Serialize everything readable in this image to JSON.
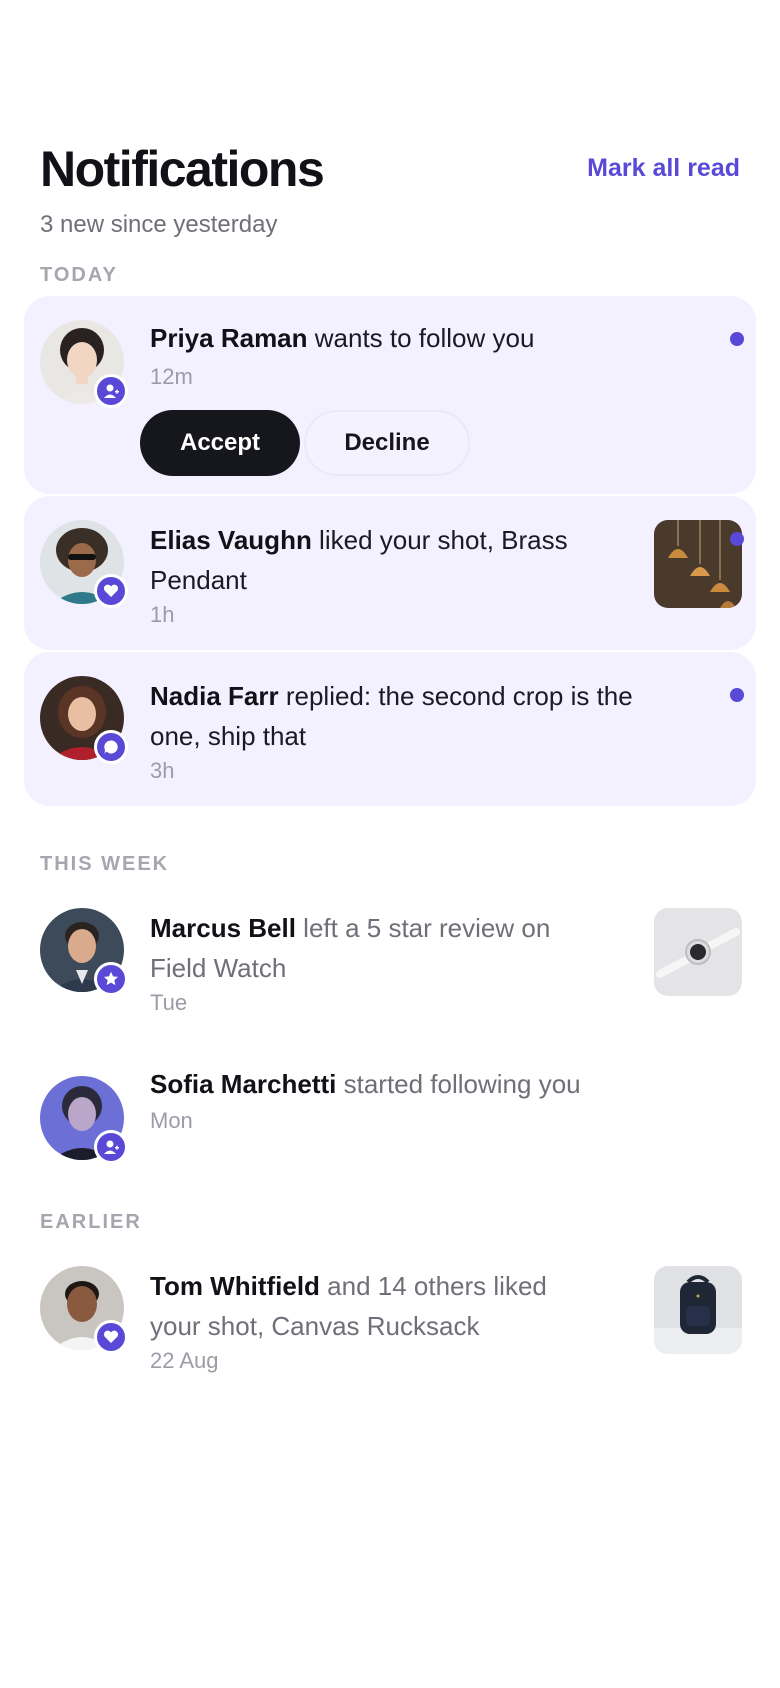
{
  "header": {
    "title": "Notifications",
    "subtitle": "3 new since yesterday",
    "mark_all": "Mark all read"
  },
  "sections": {
    "today": "TODAY",
    "this_week": "THIS WEEK",
    "earlier": "EARLIER"
  },
  "colors": {
    "accent": "#5a49d6",
    "unread_bg": "#f3f1ff",
    "primary_button": "#16161d"
  },
  "notifications": [
    {
      "name": "Priya Raman",
      "action": " wants to follow you",
      "time": "12m",
      "unread": true,
      "badge_icon": "user-plus-icon",
      "accept_label": "Accept",
      "decline_label": "Decline"
    },
    {
      "name": "Elias Vaughn",
      "action": " liked your shot, Brass Pendant",
      "time": "1h",
      "unread": true,
      "badge_icon": "heart-icon",
      "thumbnail": "brass-pendant-thumbnail"
    },
    {
      "name": "Nadia Farr",
      "action": " replied: the second crop is the one, ship that",
      "time": "3h",
      "unread": true,
      "badge_icon": "comment-icon"
    },
    {
      "name": "Marcus Bell",
      "action": " left a 5 star review on Field Watch",
      "time": "Tue",
      "unread": false,
      "badge_icon": "star-icon",
      "thumbnail": "field-watch-thumbnail"
    },
    {
      "name": "Sofia Marchetti",
      "action": " started following you",
      "time": "Mon",
      "unread": false,
      "badge_icon": "user-plus-icon"
    },
    {
      "name": "Tom Whitfield",
      "action": " and 14 others liked your shot, Canvas Rucksack",
      "time": "22 Aug",
      "unread": false,
      "badge_icon": "heart-icon",
      "thumbnail": "canvas-rucksack-thumbnail"
    }
  ]
}
